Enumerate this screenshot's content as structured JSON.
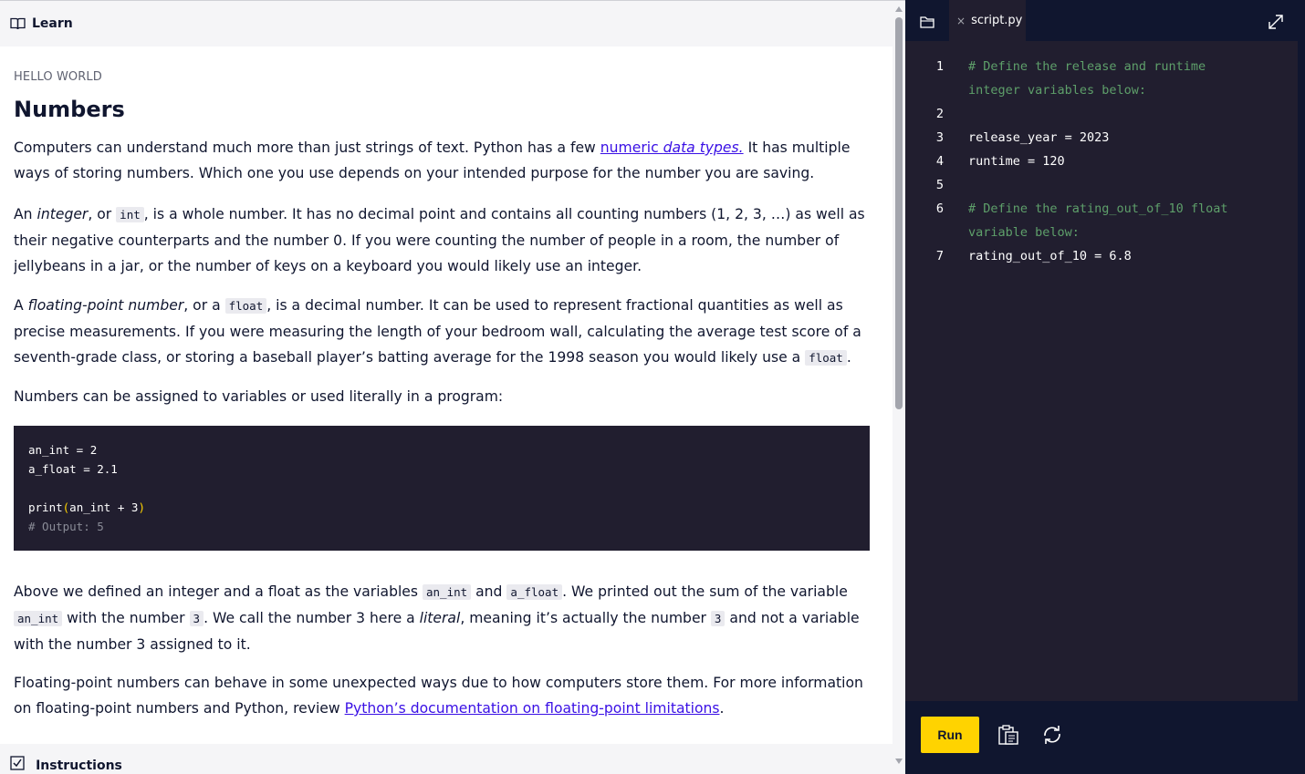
{
  "learn": {
    "header_label": "Learn",
    "eyebrow": "HELLO WORLD",
    "title": "Numbers",
    "p1": {
      "a": "Computers can understand much more than just strings of text. Python has a few ",
      "link": "numeric data types.",
      "b": " It has multiple ways of storing numbers. Which one you use depends on your intended purpose for the number you are saving."
    },
    "p2": {
      "a": "An ",
      "em": "integer",
      "b": ", or ",
      "code": "int",
      "c": ", is a whole number. It has no decimal point and contains all counting numbers (1, 2, 3, …) as well as their negative counterparts and the number 0. If you were counting the number of people in a room, the number of jellybeans in a jar, or the number of keys on a keyboard you would likely use an integer."
    },
    "p3": {
      "a": "A ",
      "em": "floating-point number",
      "b": ", or a ",
      "code": "float",
      "c": ", is a decimal number. It can be used to represent fractional quantities as well as precise measurements. If you were measuring the length of your bedroom wall, calculating the average test score of a seventh-grade class, or storing a baseball player’s batting average for the 1998 season you would likely use a ",
      "code2": "float",
      "d": "."
    },
    "p4": "Numbers can be assigned to variables or used literally in a program:",
    "code_block": {
      "line1": "an_int = 2",
      "line2": "a_float = 2.1",
      "line4_a": "print",
      "line4_paren_open": "(",
      "line4_b": "an_int + 3",
      "line4_paren_close": ")",
      "line5": "# Output: 5"
    },
    "p5": {
      "a": "Above we defined an integer and a float as the variables ",
      "code1": "an_int",
      "b": " and ",
      "code2": "a_float",
      "c": ". We printed out the sum of the variable ",
      "code3": "an_int",
      "d": " with the number ",
      "code4": "3",
      "e": ". We call the number 3 here a ",
      "em": "literal",
      "f": ", meaning it’s actually the number ",
      "code5": "3",
      "g": " and not a variable with the number 3 assigned to it."
    },
    "p6": {
      "a": "Floating-point numbers can behave in some unexpected ways due to how computers store them. For more information on floating-point numbers and Python, review ",
      "link": "Python’s documentation on floating-point limitations",
      "b": "."
    },
    "instructions_label": "Instructions"
  },
  "editor": {
    "tab_close": "×",
    "tab_name": "script.py",
    "gutter": [
      "1",
      "2",
      "3",
      "4",
      "5",
      "6",
      "7"
    ],
    "lines": {
      "l1a": "# Define the release and runtime",
      "l1b": "integer variables below:",
      "l3": "release_year = 2023",
      "l4": "runtime = 120",
      "l6a": "# Define the rating_out_of_10 float",
      "l6b": "variable below:",
      "l7": "rating_out_of_10 = 6.8"
    },
    "run_label": "Run"
  },
  "colors": {
    "accent_yellow": "#ffd300",
    "link": "#3a10e5",
    "editor_bg": "#211e2f",
    "navy": "#10162f",
    "comment_green": "#5e9f6a"
  },
  "icons": [
    "book-icon",
    "checkbox-icon",
    "folder-icon",
    "close-icon",
    "expand-icon",
    "clipboard-icon",
    "refresh-icon"
  ]
}
